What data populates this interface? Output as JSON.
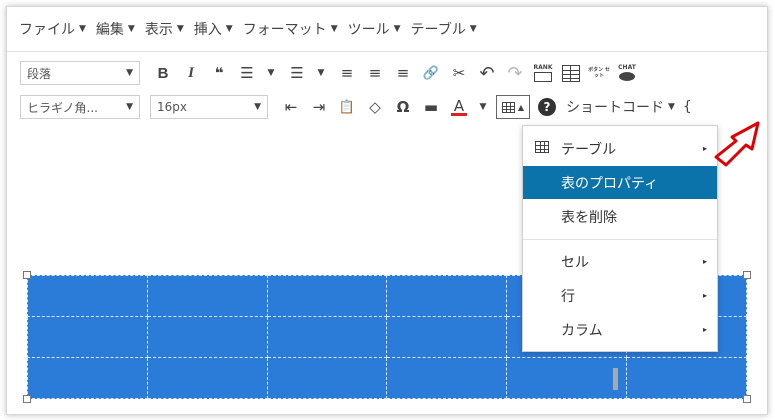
{
  "menubar": {
    "items": [
      {
        "label": "ファイル"
      },
      {
        "label": "編集"
      },
      {
        "label": "表示"
      },
      {
        "label": "挿入"
      },
      {
        "label": "フォーマット"
      },
      {
        "label": "ツール"
      },
      {
        "label": "テーブル"
      }
    ],
    "caret": "▼"
  },
  "toolbar1": {
    "format_select": "段落",
    "bold": "B",
    "italic": "I",
    "blockquote": "❝",
    "bullet_list": "☰",
    "numbered_list": "☰",
    "align_left": "≡",
    "align_center": "≡",
    "align_right": "≡",
    "link": "🔗",
    "unlink": "✂",
    "undo": "↶",
    "redo": "↷",
    "rank_label": "RANK",
    "button_label": "ボタン セット",
    "chat_label": "CHAT"
  },
  "toolbar2": {
    "font_select": "ヒラギノ角...",
    "size_select": "16px",
    "outdent": "⇤",
    "indent": "⇥",
    "paste": "📋",
    "clear": "◇",
    "omega": "Ω",
    "hr": "▬",
    "text_color": "A",
    "table_caret": "▲",
    "help": "?",
    "shortcode": "ショートコード",
    "extra": "{"
  },
  "dropdown": {
    "items": [
      {
        "label": "テーブル",
        "submenu": true
      },
      {
        "label": "表のプロパティ",
        "submenu": false,
        "active": true
      },
      {
        "label": "表を削除",
        "submenu": false
      },
      {
        "label": "セル",
        "submenu": true
      },
      {
        "label": "行",
        "submenu": true
      },
      {
        "label": "カラム",
        "submenu": true
      }
    ],
    "arrow": "▸"
  },
  "content_table": {
    "rows": 3,
    "cols": 6,
    "fill": "#2b7bd9"
  },
  "colors": {
    "accent_active": "#0b73aa",
    "table_fill": "#2b7bd9",
    "annotation_arrow": "#e00000",
    "text_color_underline": "#e02020"
  },
  "icons": {
    "annotation": "red-pointer-arrow-icon",
    "table": "table-grid-icon"
  }
}
